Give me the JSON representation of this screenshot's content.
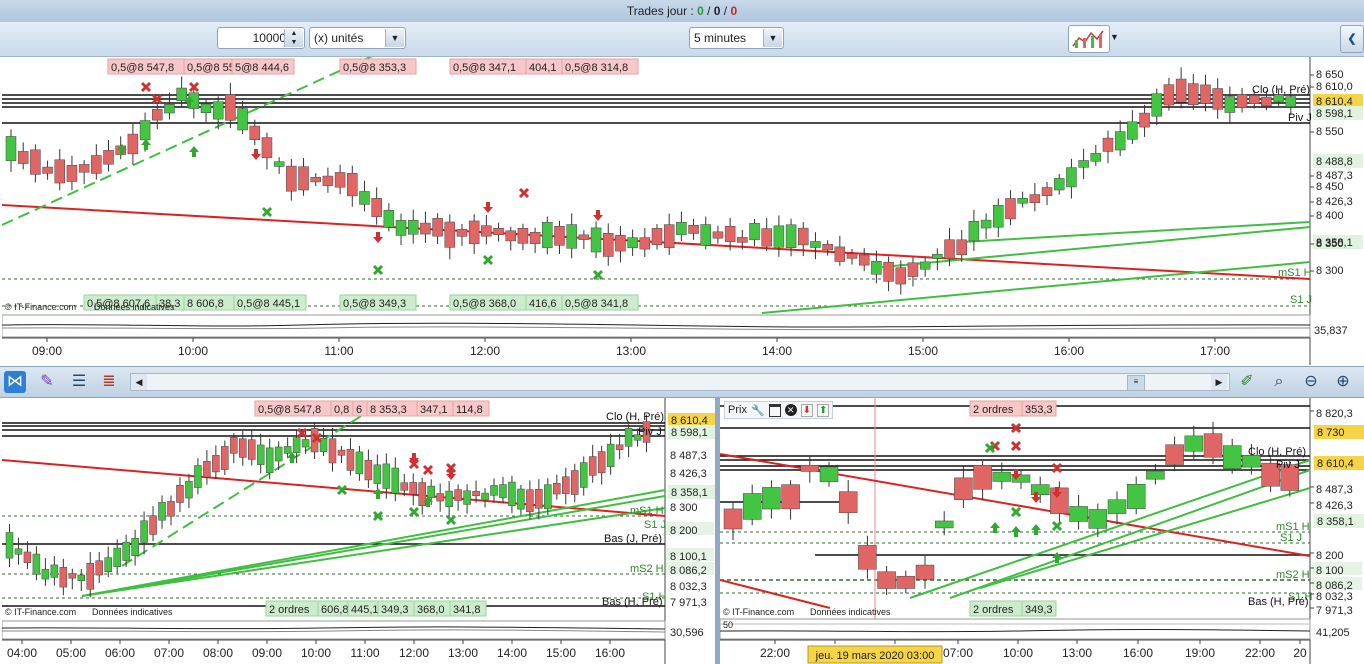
{
  "header": {
    "title_prefix": "Trades jour : ",
    "val1": "0",
    "sep1": " / ",
    "val2": "0",
    "sep2": " / ",
    "val3": "0"
  },
  "toolbar": {
    "quantity_value": "10000",
    "unit_select": "(x) unités",
    "interval_select": "5 minutes"
  },
  "colors": {
    "up": "#43c443",
    "down": "#e06666",
    "trend_red": "#e02020",
    "trend_green": "#3fbf3f",
    "accent_yellow": "#f5d547"
  },
  "main_chart": {
    "order_tags_top": [
      "0,5@8 547,8",
      "0,5@8 556,8",
      "5@8 444,6",
      "0,5@8 353,3",
      "0,5@8 347,1",
      "404,1",
      "0,5@8 314,8"
    ],
    "order_tags_bottom": [
      "0,5@8 607,6",
      "38,3",
      "8 606,8",
      "0,5@8 445,1",
      "0,5@8 349,3",
      "0,5@8 368,0",
      "416,6",
      "0,5@8 341,8"
    ],
    "price_labels": [
      "8 650",
      "8 610,0",
      "8 610,4",
      "8 598,1",
      "8 550",
      "8 488,8",
      "8 487,3",
      "8 450",
      "8 426,3",
      "8 400",
      "8 358,1",
      "8 350",
      "8 300"
    ],
    "line_labels": [
      "Clo (H, Pré)",
      "Piv J",
      "mS1 H",
      "S1 J"
    ],
    "copyright": "© IT-Finance.com",
    "copyright_note": "Données indicatives",
    "indicator_value": "35,837",
    "time_ticks": [
      "09:00",
      "10:00",
      "11:00",
      "12:00",
      "13:00",
      "14:00",
      "15:00",
      "16:00",
      "17:00"
    ]
  },
  "left_chart": {
    "order_tags_top": [
      "0,5@8 547,8",
      "0,8",
      "6",
      "8 353,3",
      "347,1",
      "114,8"
    ],
    "order_tags_bottom": [
      "2 ordres",
      "606,8",
      "445,1",
      "349,3",
      "368,0",
      "341,8"
    ],
    "price_labels": [
      "8 610,4",
      "8 598,1",
      "8 487,3",
      "8 426,3",
      "8 358,1",
      "8 300",
      "8 200",
      "8 100,1",
      "8 086,2",
      "8 032,3",
      "7 971,3"
    ],
    "line_labels": [
      "Clo (H, Pré)",
      "Piv J",
      "mS1 H",
      "S1 J",
      "Bas (J, Pré)",
      "mS2 H",
      "S1 H",
      "Bas (H, Pré)"
    ],
    "copyright": "© IT-Finance.com",
    "copyright_note": "Données indicatives",
    "indicator_value": "30,596",
    "time_ticks": [
      "04:00",
      "05:00",
      "06:00",
      "07:00",
      "08:00",
      "09:00",
      "10:00",
      "11:00",
      "12:00",
      "13:00",
      "14:00",
      "15:00",
      "16:00"
    ]
  },
  "right_chart": {
    "prix_label": "Prix",
    "order_tags_top": [
      "2 ordres",
      "353,3"
    ],
    "order_tags_bottom": [
      "2 ordres",
      "349,3"
    ],
    "price_labels": [
      "8 820,3",
      "8 730",
      "8 610,4",
      "8 487,3",
      "8 426,3",
      "8 358,1",
      "8 200",
      "8 100",
      "8 086,2",
      "8 032,3",
      "7 971,3"
    ],
    "line_labels": [
      "Clo (H, Pré)",
      "Piv J",
      "mS1 H",
      "S1 J",
      "mS2 H",
      "S1 H",
      "Bas (H, Pré)"
    ],
    "copyright": "© IT-Finance.com",
    "copyright_note": "Données indicatives",
    "indicator_value": "41,205",
    "indicator_level": "50",
    "date_flag": "jeu. 19 mars 2020 03:00",
    "time_ticks": [
      "22:00",
      "01:00",
      "04:00",
      "07:00",
      "10:00",
      "13:00",
      "16:00",
      "19:00",
      "22:00",
      "20"
    ]
  }
}
